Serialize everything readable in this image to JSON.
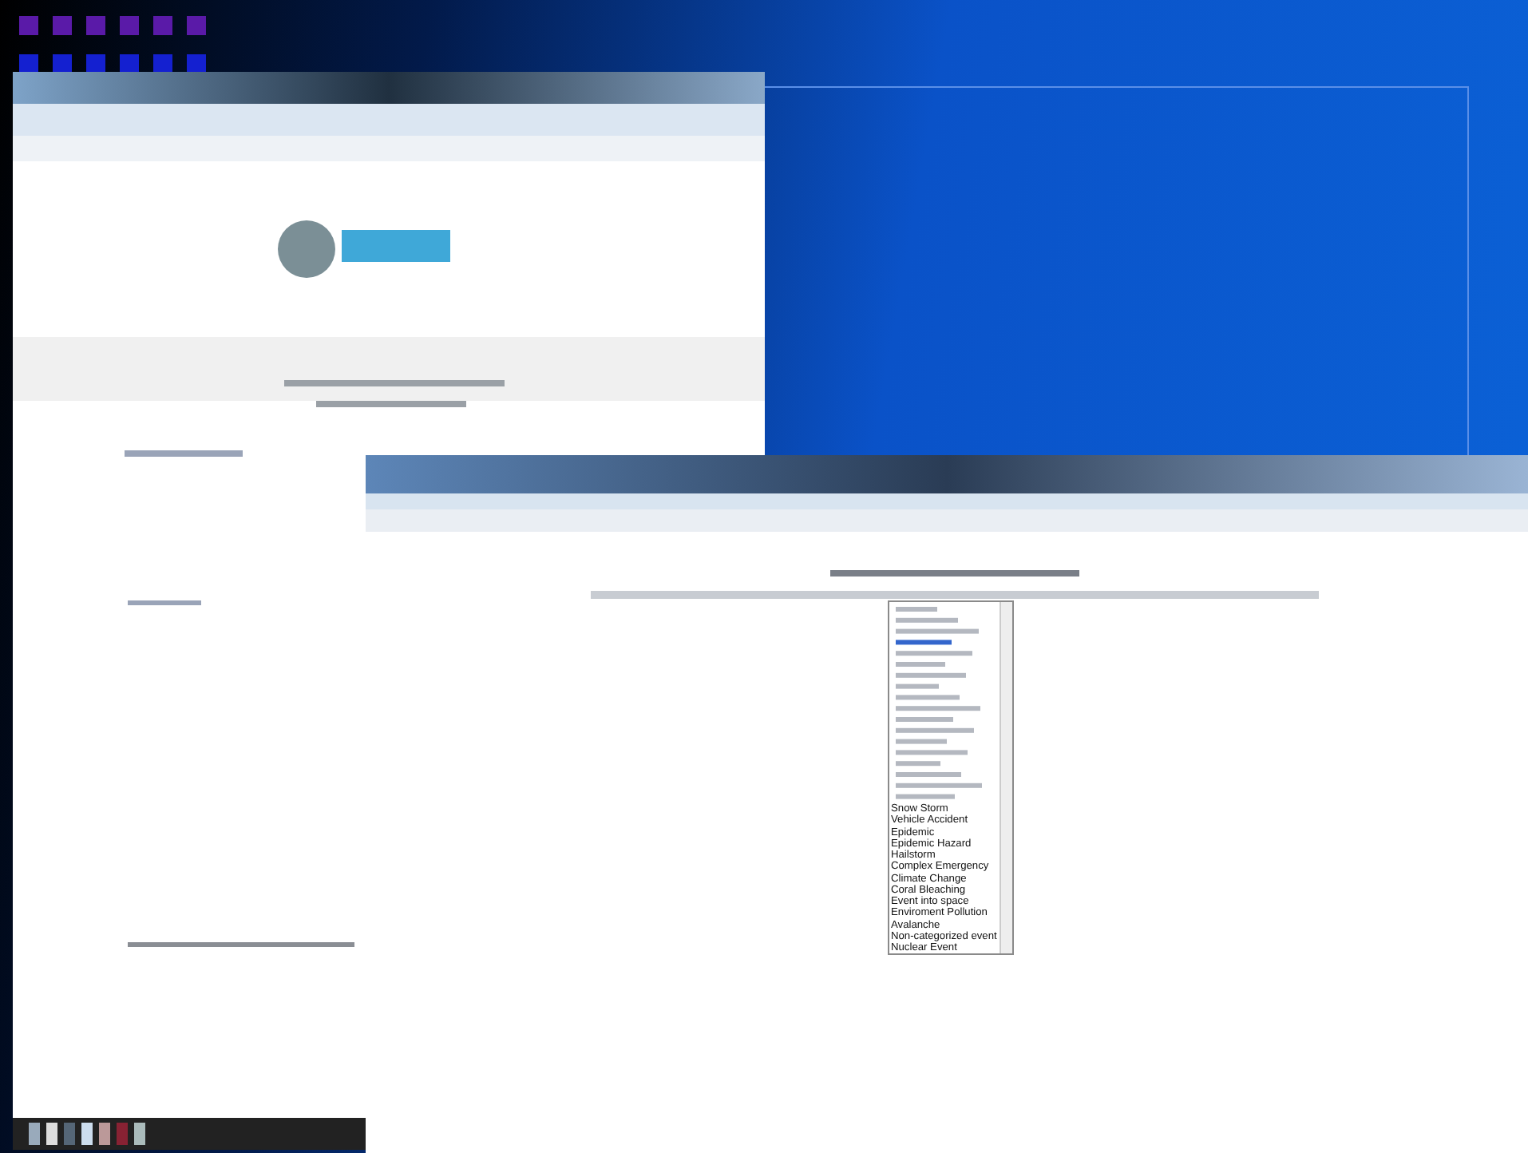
{
  "front_window": {
    "category_dropdown": {
      "items": [
        {
          "label": "Snow Storm"
        },
        {
          "label": "Vehicle Accident"
        },
        {
          "label": "Epidemic"
        },
        {
          "label": "Epidemic Hazard"
        },
        {
          "label": "Hailstorm"
        },
        {
          "label": "Complex Emergency"
        },
        {
          "label": "Climate Change"
        },
        {
          "label": "Coral Bleaching"
        },
        {
          "label": "Event into space"
        },
        {
          "label": "Enviroment Pollution"
        },
        {
          "label": "Avalanche"
        },
        {
          "label": "Non-categorized event"
        },
        {
          "label": "Nuclear Event"
        }
      ]
    }
  }
}
